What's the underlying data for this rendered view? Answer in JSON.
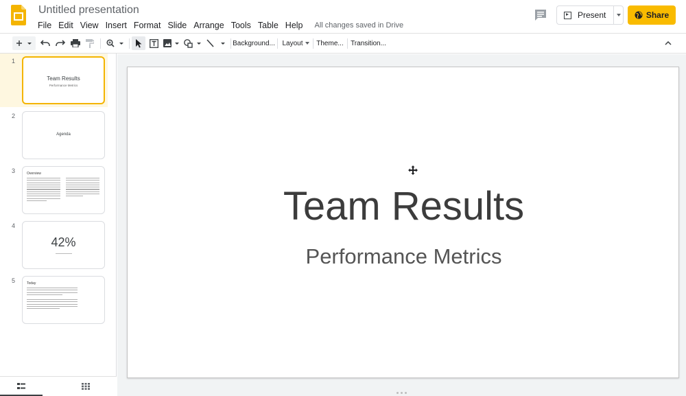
{
  "header": {
    "title": "Untitled presentation",
    "menu": [
      "File",
      "Edit",
      "View",
      "Insert",
      "Format",
      "Slide",
      "Arrange",
      "Tools",
      "Table",
      "Help"
    ],
    "save_status": "All changes saved in Drive",
    "present_label": "Present",
    "share_label": "Share",
    "brand_color": "#f4b400",
    "share_color": "#f9bb00"
  },
  "toolbar": {
    "background_label": "Background...",
    "layout_label": "Layout",
    "theme_label": "Theme...",
    "transition_label": "Transition..."
  },
  "filmstrip": {
    "selected_index": 1,
    "slides": [
      {
        "number": "1",
        "title": "Team Results",
        "subtitle": "Performance Metrics"
      },
      {
        "number": "2",
        "title": "Agenda"
      },
      {
        "number": "3",
        "heading": "Overview"
      },
      {
        "number": "4",
        "big": "42%"
      },
      {
        "number": "5",
        "heading": "Today"
      }
    ]
  },
  "slide": {
    "title": "Team Results",
    "subtitle": "Performance Metrics"
  }
}
